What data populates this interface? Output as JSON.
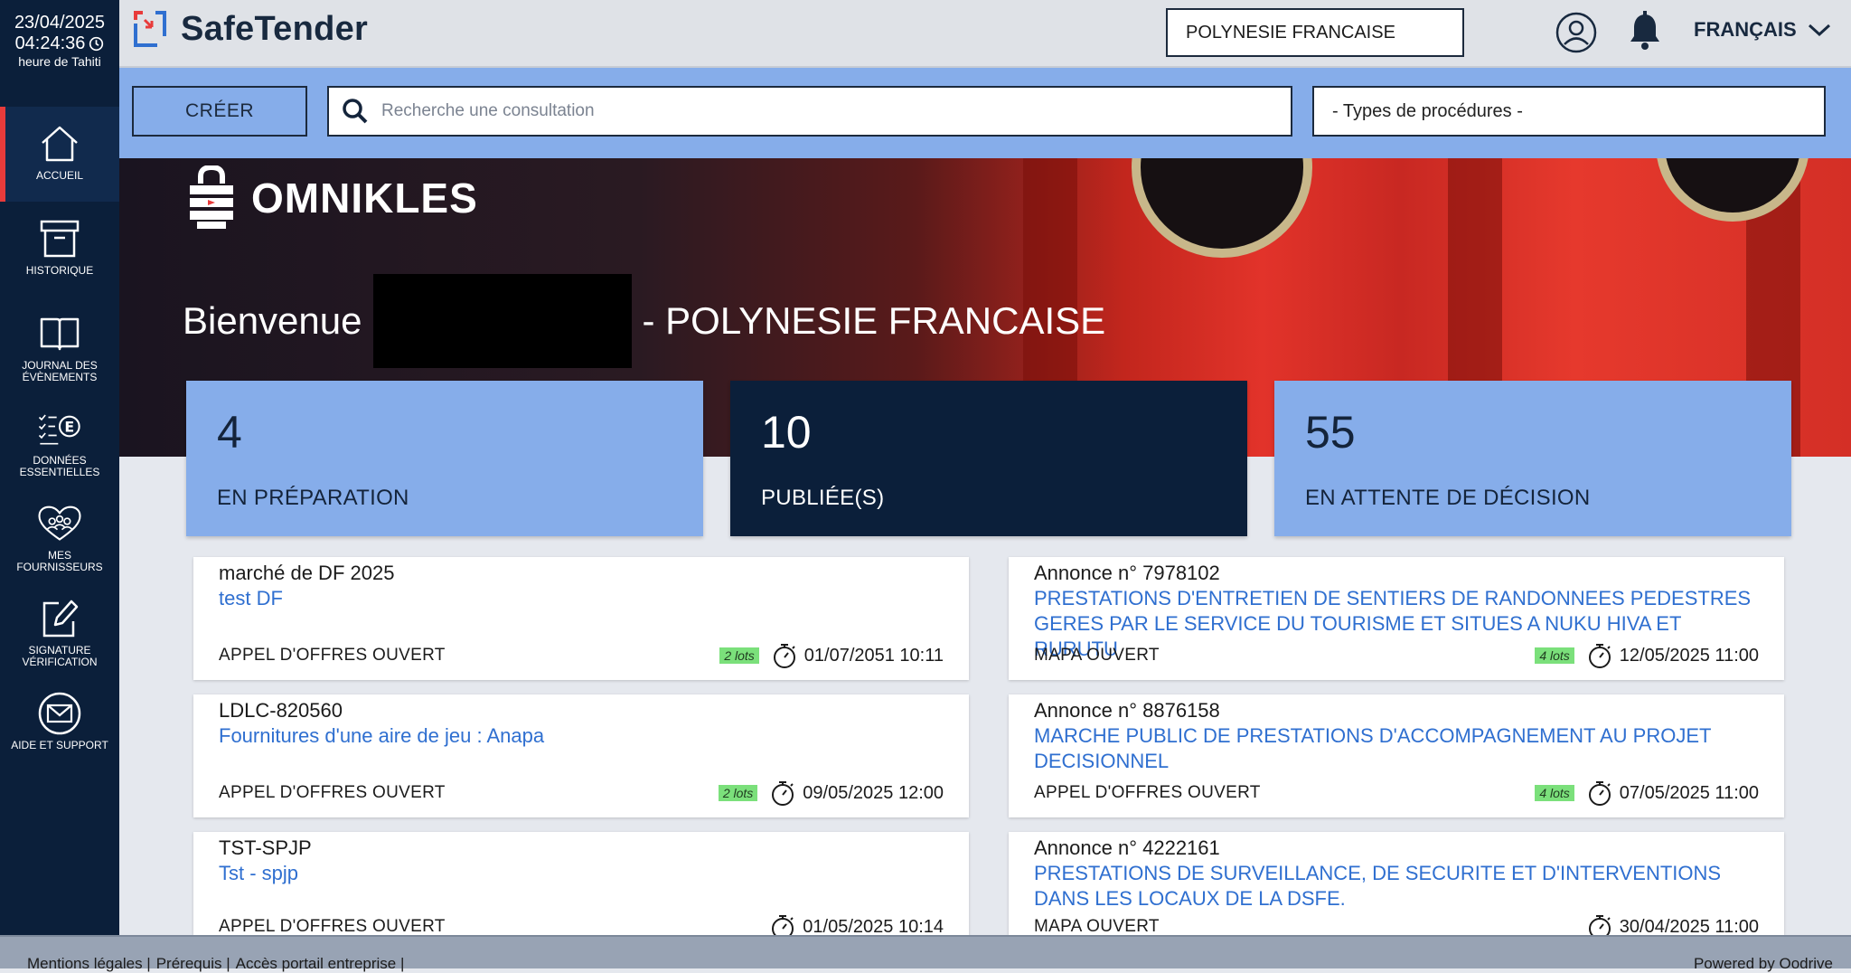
{
  "clock": {
    "date": "23/04/2025",
    "time": "04:24:36",
    "timezone": "heure de Tahiti"
  },
  "sidebar": {
    "items": [
      {
        "label": "ACCUEIL",
        "icon": "home-icon"
      },
      {
        "label": "HISTORIQUE",
        "icon": "archive-icon"
      },
      {
        "label": "JOURNAL DES ÉVÈNEMENTS",
        "icon": "book-icon"
      },
      {
        "label": "DONNÉES ESSENTIELLES",
        "icon": "checklist-e-icon"
      },
      {
        "label": "MES FOURNISSEURS",
        "icon": "heart-people-icon"
      },
      {
        "label": "SIGNATURE VÉRIFICATION",
        "icon": "pen-square-icon"
      },
      {
        "label": "AIDE ET SUPPORT",
        "icon": "mail-icon"
      }
    ]
  },
  "header": {
    "app_name": "SafeTender",
    "organization": "POLYNESIE FRANCAISE",
    "language": "FRANÇAIS"
  },
  "actions": {
    "create_label": "CRÉER",
    "search_placeholder": "Recherche une consultation",
    "procedure_types": "- Types de procédures -"
  },
  "hero": {
    "logo_text": "OMNIKLES",
    "welcome_prefix": "Bienvenue",
    "welcome_suffix": "- POLYNESIE FRANCAISE"
  },
  "stats": [
    {
      "value": "4",
      "label": "EN PRÉPARATION"
    },
    {
      "value": "10",
      "label": "PUBLIÉE(S)"
    },
    {
      "value": "55",
      "label": "EN ATTENTE DE DÉCISION"
    }
  ],
  "left_cards": [
    {
      "ref": "marché de DF 2025",
      "object": "test DF",
      "type": "APPEL D'OFFRES OUVERT",
      "lots": "2 lots",
      "deadline": "01/07/2051 10:11"
    },
    {
      "ref": "LDLC-820560",
      "object": "Fournitures d'une aire de jeu : Anapa",
      "type": "APPEL D'OFFRES OUVERT",
      "lots": "2 lots",
      "deadline": "09/05/2025 12:00"
    },
    {
      "ref": "TST-SPJP",
      "object": "Tst - spjp",
      "type": "APPEL D'OFFRES OUVERT",
      "lots": "",
      "deadline": "01/05/2025 10:14"
    }
  ],
  "right_cards": [
    {
      "ref": "Annonce n° 7978102",
      "object": "PRESTATIONS D'ENTRETIEN DE SENTIERS DE RANDONNEES PEDESTRES GERES PAR LE SERVICE DU TOURISME ET SITUES A NUKU HIVA ET RURUTU",
      "type": "MAPA OUVERT",
      "lots": "4 lots",
      "deadline": "12/05/2025 11:00"
    },
    {
      "ref": "Annonce n° 8876158",
      "object": "MARCHE PUBLIC DE PRESTATIONS D'ACCOMPAGNEMENT AU PROJET DECISIONNEL",
      "type": "APPEL D'OFFRES OUVERT",
      "lots": "4 lots",
      "deadline": "07/05/2025 11:00"
    },
    {
      "ref": "Annonce n° 4222161",
      "object": "PRESTATIONS DE SURVEILLANCE, DE SECURITE ET D'INTERVENTIONS DANS LES LOCAUX DE LA DSFE.",
      "type": "MAPA OUVERT",
      "lots": "",
      "deadline": "30/04/2025 11:00"
    }
  ],
  "footer": {
    "links": [
      "Mentions légales |",
      "Prérequis |",
      "Accès portail entreprise |"
    ],
    "powered": "Powered by Oodrive"
  },
  "colors": {
    "navy": "#0b1f3a",
    "accent_blue": "#86adea",
    "link_blue": "#2f6fd0",
    "lots_green": "#7be07b",
    "active_red": "#e83b3b"
  }
}
